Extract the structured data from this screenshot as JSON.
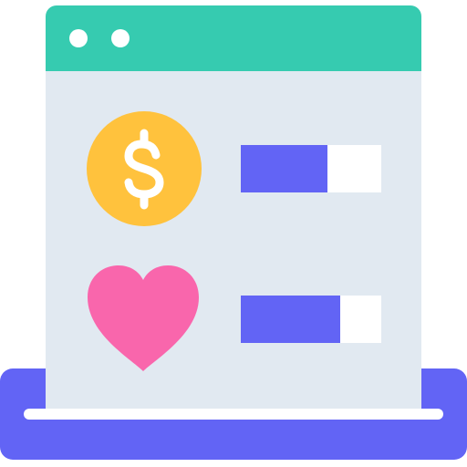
{
  "colors": {
    "titlebar": "#36CBB0",
    "window_body": "#E1E9F1",
    "tray": "#6264F5",
    "coin": "#FFC23D",
    "heart": "#F966AC",
    "meter_fill": "#6264F5"
  },
  "icons": {
    "coin": "dollar-coin-icon",
    "heart": "heart-icon"
  },
  "rows": [
    {
      "icon": "dollar-coin-icon",
      "level": 0.62
    },
    {
      "icon": "heart-icon",
      "level": 0.71
    }
  ]
}
